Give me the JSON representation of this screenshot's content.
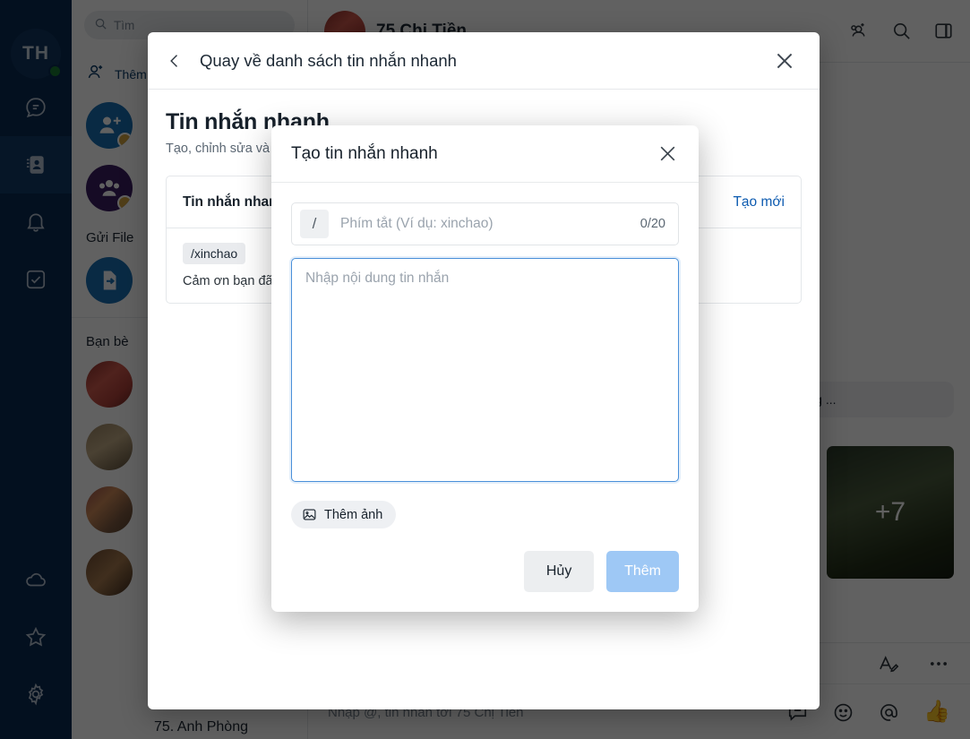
{
  "rail": {
    "avatar_initials": "TH",
    "items": [
      {
        "name": "messages",
        "icon": "chat-bubble-icon",
        "active": false
      },
      {
        "name": "contacts",
        "icon": "contacts-book-icon",
        "active": true
      },
      {
        "name": "notifications",
        "icon": "bell-icon",
        "active": false
      },
      {
        "name": "tasks",
        "icon": "checkbox-icon",
        "active": false
      },
      {
        "name": "cloud",
        "icon": "cloud-icon",
        "active": false
      },
      {
        "name": "favorites",
        "icon": "star-icon",
        "active": false
      },
      {
        "name": "settings",
        "icon": "gear-icon",
        "active": false
      }
    ]
  },
  "sidebar": {
    "search_placeholder": "Tìm",
    "friend_invite_label": "Thêm",
    "sections": [
      {
        "label": "Gửi File"
      },
      {
        "label": "Bạn bè"
      }
    ],
    "bottom_name": "75. Anh Phòng"
  },
  "chat": {
    "title": "75 Chị Tiền",
    "header_icons": [
      "add-member-icon",
      "search-icon",
      "panel-toggle-icon"
    ],
    "message_preview": "nhũng ...",
    "attachment_more": "+7",
    "composer_placeholder": "Nhập @, tin nhắn tới 75 Chị Tiền",
    "tool_icons": [
      "text-format-icon",
      "more-options-icon"
    ],
    "input_icons": [
      "sticker-icon",
      "emoji-icon",
      "mention-icon"
    ],
    "thumb_up": "👍"
  },
  "panel": {
    "back_label": "Quay về danh sách tin nhắn nhanh",
    "title": "Tin nhắn nhanh",
    "subtitle": "Tạo, chỉnh sửa và sử dụng tin nhắn nhanh trong hội thoại.",
    "card": {
      "header_left": "Tin nhắn nhanh",
      "header_right": "Tạo mới",
      "item_tag": "/xinchao",
      "item_text": "Cảm ơn bạn đã liên hệ"
    }
  },
  "modal": {
    "title": "Tạo tin nhắn nhanh",
    "slash_prefix": "/",
    "shortcut_placeholder": "Phím tắt (Ví dụ: xinchao)",
    "shortcut_value": "",
    "counter": "0/20",
    "content_placeholder": "Nhập nội dung tin nhắn",
    "content_value": "",
    "add_image_label": "Thêm ảnh",
    "cancel_label": "Hủy",
    "submit_label": "Thêm"
  },
  "colors": {
    "rail_bg": "#0a2a52",
    "accent_link": "#0d5bb0",
    "primary_button": "#9ec8f5",
    "focus_border": "#4a90d9"
  }
}
